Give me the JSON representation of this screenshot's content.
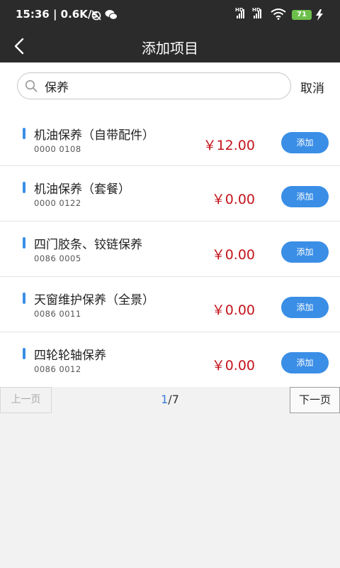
{
  "status_bar": {
    "time_speed": "15:36 | 0.6K/s",
    "battery": "71"
  },
  "header": {
    "title": "添加项目"
  },
  "search": {
    "value": "保养",
    "cancel_label": "取消"
  },
  "items": [
    {
      "name": "机油保养（自带配件）",
      "code": "0000 0108",
      "price": "￥12.00",
      "add_label": "添加"
    },
    {
      "name": "机油保养（套餐）",
      "code": "0000 0122",
      "price": "￥0.00",
      "add_label": "添加"
    },
    {
      "name": "四门胶条、铰链保养",
      "code": "0086 0005",
      "price": "￥0.00",
      "add_label": "添加"
    },
    {
      "name": "天窗维护保养（全景）",
      "code": "0086 0011",
      "price": "￥0.00",
      "add_label": "添加"
    },
    {
      "name": "四轮轮轴保养",
      "code": "0086 0012",
      "price": "￥0.00",
      "add_label": "添加"
    }
  ],
  "pager": {
    "prev_label": "上一页",
    "current_page": "1",
    "total_pages": "/7",
    "next_label": "下一页"
  },
  "colors": {
    "header_bg": "#2b2b2b",
    "accent_blue": "#3a8ee6",
    "price_red": "#c4141b",
    "battery_green": "#6cc04a"
  }
}
